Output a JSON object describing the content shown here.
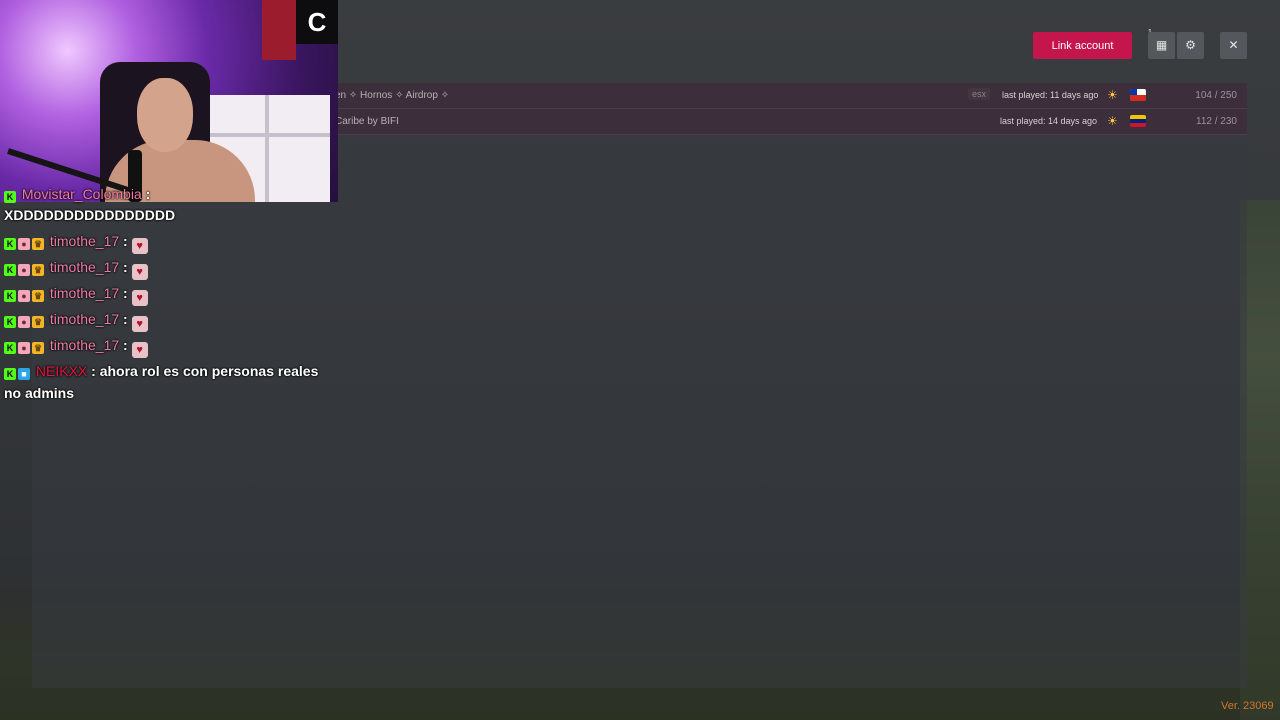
{
  "header": {
    "link_account_label": "Link account",
    "notification_count": "1",
    "notifications_icon": "notifications-icon",
    "settings_icon": "gear-icon",
    "close_icon": "close-icon"
  },
  "servers": [
    {
      "name": "en ✧ Hornos ✧ Airdrop ✧",
      "tag": "esx",
      "last_played": "last played: 11 days ago",
      "flag": "chile",
      "players": "104 / 250"
    },
    {
      "name": "Caribe by BIFI",
      "tag": "",
      "last_played": "last played: 14 days ago",
      "flag": "venezuela",
      "players": "112 / 230"
    }
  ],
  "version": "Ver. 23069",
  "chat": {
    "messages": [
      {
        "user": "Movistar_Colombia",
        "sep": " :",
        "text": ""
      },
      {
        "user": "",
        "sep": "",
        "text": "XDDDDDDDDDDDDDDDD"
      },
      {
        "user": "timothe_17",
        "sep": " :",
        "text": ""
      },
      {
        "user": "timothe_17",
        "sep": " :",
        "text": ""
      },
      {
        "user": "timothe_17",
        "sep": " :",
        "text": ""
      },
      {
        "user": "timothe_17",
        "sep": " :",
        "text": ""
      },
      {
        "user": "timothe_17",
        "sep": " :",
        "text": ""
      },
      {
        "user": "NEIKXX",
        "sep": " :",
        "text": " ahora rol es con personas reales no admins"
      }
    ]
  },
  "colors": {
    "accent": "#c4164c",
    "version": "#d4762a",
    "username_pink": "#f07aa4",
    "username_red": "#e6123d",
    "kick_badge": "#53fc18"
  }
}
